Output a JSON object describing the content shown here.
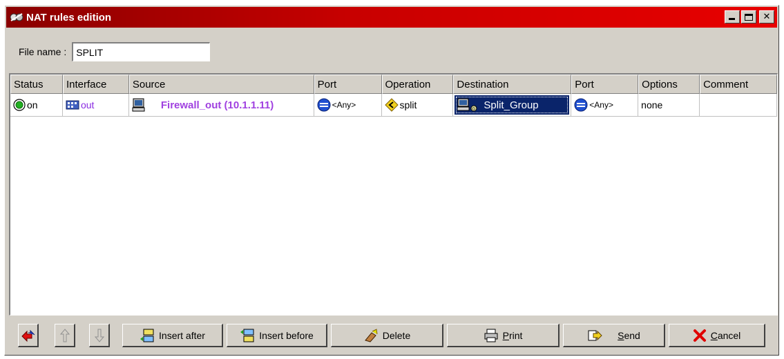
{
  "window": {
    "title": "NAT rules edition"
  },
  "file": {
    "label": "File name :",
    "value": "SPLIT"
  },
  "columns": [
    "Status",
    "Interface",
    "Source",
    "Port",
    "Operation",
    "Destination",
    "Port",
    "Options",
    "Comment"
  ],
  "rule": {
    "status": "on",
    "interface": "out",
    "source": "Firewall_out (10.1.1.11)",
    "source_port": "<Any>",
    "operation": "split",
    "destination": "Split_Group",
    "destination_port": "<Any>",
    "options": "none",
    "comment": ""
  },
  "buttons": {
    "insert_after": "Insert after",
    "insert_before": "Insert before",
    "delete": "Delete",
    "print_rest": "rint",
    "print_key": "P",
    "send_rest": "end",
    "send_key": "S",
    "cancel_rest": "ancel",
    "cancel_key": "C"
  },
  "colors": {
    "title_gradient_start": "#8a0000",
    "title_gradient_end": "#e80000",
    "selection": "#0a246a",
    "source_text": "#a040e0",
    "interface_text": "#8a2be2"
  }
}
